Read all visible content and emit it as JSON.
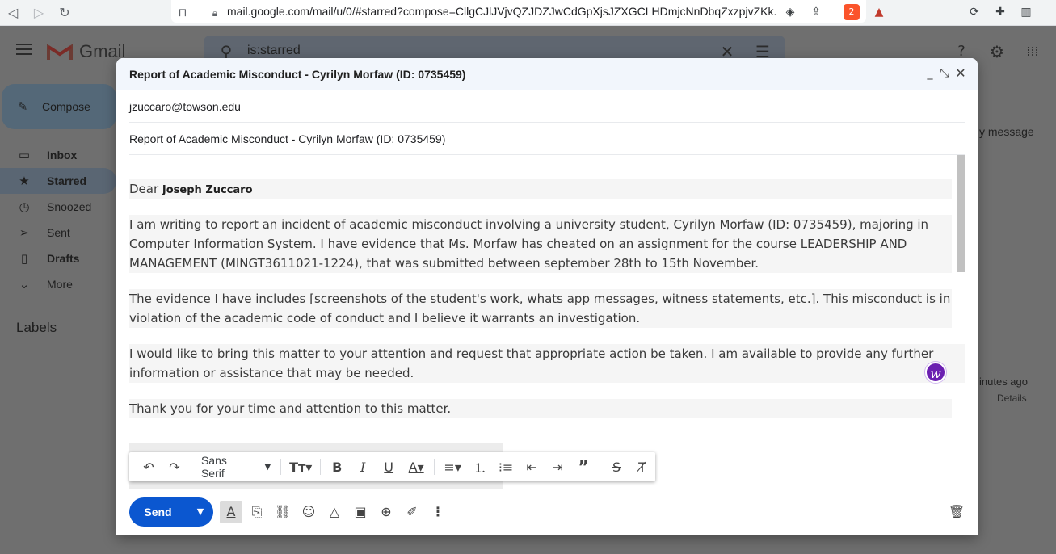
{
  "browser": {
    "url": "mail.google.com/mail/u/0/#starred?compose=CllgCJlJVjvQZJDZJwCdGpXjsJZXGCLHDmjcNnDbqZxzpjvZKk...",
    "brave_badge_count": "2"
  },
  "gmail": {
    "logo_text": "Gmail",
    "search_value": "is:starred",
    "compose_label": "Compose",
    "nav": [
      {
        "label": "Inbox"
      },
      {
        "label": "Starred"
      },
      {
        "label": "Snoozed"
      },
      {
        "label": "Sent"
      },
      {
        "label": "Drafts"
      },
      {
        "label": "More"
      }
    ],
    "labels_heading": "Labels",
    "bg_message": "y message",
    "bg_minutes": "inutes ago",
    "bg_details": "Details"
  },
  "compose": {
    "title": "Report of Academic Misconduct - Cyrilyn Morfaw (ID: 0735459)",
    "to": "jzuccaro@towson.edu",
    "subject": "Report of Academic Misconduct - Cyrilyn Morfaw (ID: 0735459)",
    "greeting_prefix": "Dear ",
    "greeting_name": "Joseph Zuccaro",
    "para1": "I am writing to report an incident of academic misconduct involving a university student, Cyrilyn Morfaw (ID: 0735459), majoring in Computer Information System. I have evidence that Ms. Morfaw has cheated on an assignment for the course LEADERSHIP AND MANAGEMENT (MINGT3611021-1224), that was submitted between september 28th to 15th November.",
    "para2": "The evidence I have includes [screenshots of the student's work, whats app messages, witness statements, etc.]. This misconduct is in violation of the academic code of conduct and I believe it warrants an investigation.",
    "para3": "I would like to bring this matter to your attention and request that appropriate action be taken. I am available to provide any further information or assistance that may be needed.",
    "para4": "Thank you for your time and attention to this matter.",
    "font_name": "Sans Serif",
    "send_label": "Send"
  },
  "colors": {
    "send_blue": "#0b57d0",
    "header_bg": "#f2f6fc",
    "badge_purple": "#6b1fb1"
  },
  "icons": {
    "browser": [
      "back-icon",
      "forward-icon",
      "reload-icon",
      "bookmark-icon",
      "lock-icon",
      "eye-icon",
      "share-icon",
      "brave-icon",
      "triangle-icon",
      "sync-icon",
      "puzzle-icon",
      "sidebar-icon"
    ],
    "formatting": [
      "undo-icon",
      "redo-icon",
      "text-size-icon",
      "bold-icon",
      "italic-icon",
      "underline-icon",
      "text-color-icon",
      "align-icon",
      "numbered-list-icon",
      "bulleted-list-icon",
      "indent-less-icon",
      "indent-more-icon",
      "quote-icon",
      "strikethrough-icon",
      "remove-formatting-icon"
    ],
    "bottom": [
      "formatting-options-icon",
      "attach-icon",
      "link-icon",
      "emoji-icon",
      "drive-icon",
      "photo-icon",
      "confidential-icon",
      "signature-icon",
      "more-options-icon",
      "trash-icon"
    ]
  }
}
